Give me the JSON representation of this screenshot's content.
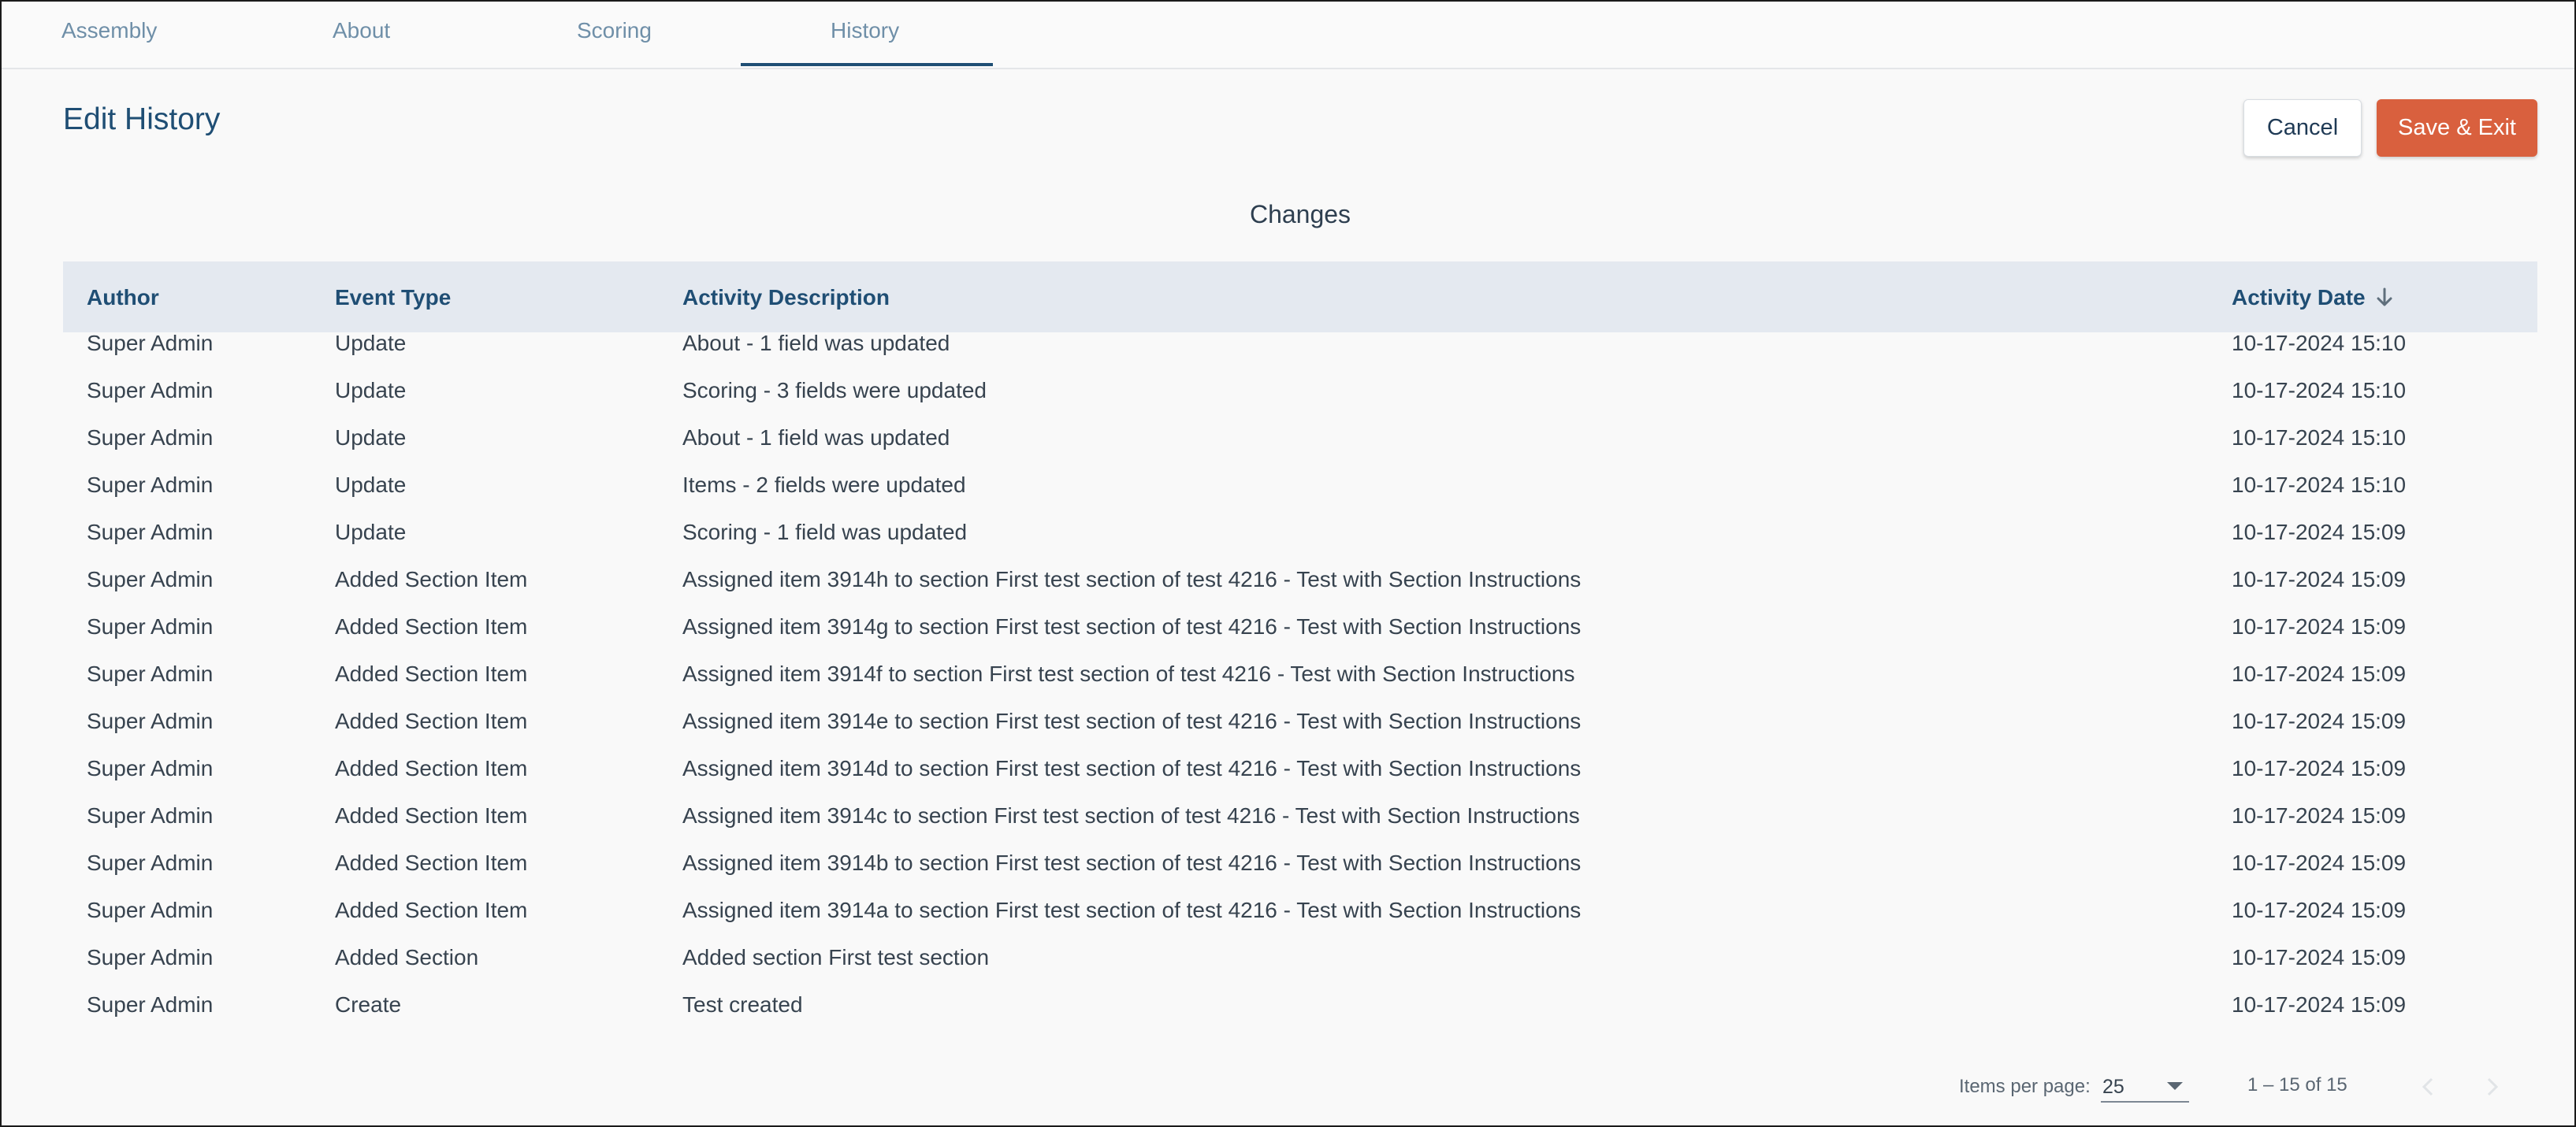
{
  "tabs": [
    {
      "label": "Assembly"
    },
    {
      "label": "About"
    },
    {
      "label": "Scoring"
    },
    {
      "label": "History"
    }
  ],
  "active_tab": "History",
  "page_title": "Edit History",
  "buttons": {
    "cancel": "Cancel",
    "save_exit": "Save & Exit"
  },
  "section_title": "Changes",
  "table": {
    "columns": [
      "Author",
      "Event Type",
      "Activity Description",
      "Activity Date"
    ],
    "sort_column": "Activity Date",
    "sort_direction": "descending",
    "rows": [
      {
        "author": "Super Admin",
        "event": "Update",
        "description": "About - 1 field was updated",
        "date": "10-17-2024 15:10"
      },
      {
        "author": "Super Admin",
        "event": "Update",
        "description": "Scoring - 3 fields were updated",
        "date": "10-17-2024 15:10"
      },
      {
        "author": "Super Admin",
        "event": "Update",
        "description": "About - 1 field was updated",
        "date": "10-17-2024 15:10"
      },
      {
        "author": "Super Admin",
        "event": "Update",
        "description": "Items - 2 fields were updated",
        "date": "10-17-2024 15:10"
      },
      {
        "author": "Super Admin",
        "event": "Update",
        "description": "Scoring - 1 field was updated",
        "date": "10-17-2024 15:09"
      },
      {
        "author": "Super Admin",
        "event": "Added Section Item",
        "description": "Assigned item 3914h to section First test section of test 4216 - Test with Section Instructions",
        "date": "10-17-2024 15:09"
      },
      {
        "author": "Super Admin",
        "event": "Added Section Item",
        "description": "Assigned item 3914g to section First test section of test 4216 - Test with Section Instructions",
        "date": "10-17-2024 15:09"
      },
      {
        "author": "Super Admin",
        "event": "Added Section Item",
        "description": "Assigned item 3914f to section First test section of test 4216 - Test with Section Instructions",
        "date": "10-17-2024 15:09"
      },
      {
        "author": "Super Admin",
        "event": "Added Section Item",
        "description": "Assigned item 3914e to section First test section of test 4216 - Test with Section Instructions",
        "date": "10-17-2024 15:09"
      },
      {
        "author": "Super Admin",
        "event": "Added Section Item",
        "description": "Assigned item 3914d to section First test section of test 4216 - Test with Section Instructions",
        "date": "10-17-2024 15:09"
      },
      {
        "author": "Super Admin",
        "event": "Added Section Item",
        "description": "Assigned item 3914c to section First test section of test 4216 - Test with Section Instructions",
        "date": "10-17-2024 15:09"
      },
      {
        "author": "Super Admin",
        "event": "Added Section Item",
        "description": "Assigned item 3914b to section First test section of test 4216 - Test with Section Instructions",
        "date": "10-17-2024 15:09"
      },
      {
        "author": "Super Admin",
        "event": "Added Section Item",
        "description": "Assigned item 3914a to section First test section of test 4216 - Test with Section Instructions",
        "date": "10-17-2024 15:09"
      },
      {
        "author": "Super Admin",
        "event": "Added Section",
        "description": "Added section First test section",
        "date": "10-17-2024 15:09"
      },
      {
        "author": "Super Admin",
        "event": "Create",
        "description": "Test created",
        "date": "10-17-2024 15:09"
      }
    ]
  },
  "paginator": {
    "items_per_page_label": "Items per page:",
    "items_per_page": "25",
    "range": "1 – 15 of 15"
  },
  "colors": {
    "accent": "#1f4e74",
    "save_button": "#d9603e",
    "header_row": "#e4e9f0"
  },
  "icons": {
    "sort": "arrow-down-icon",
    "select": "caret-down-icon",
    "prev_page": "chevron-left-icon",
    "next_page": "chevron-right-icon"
  }
}
